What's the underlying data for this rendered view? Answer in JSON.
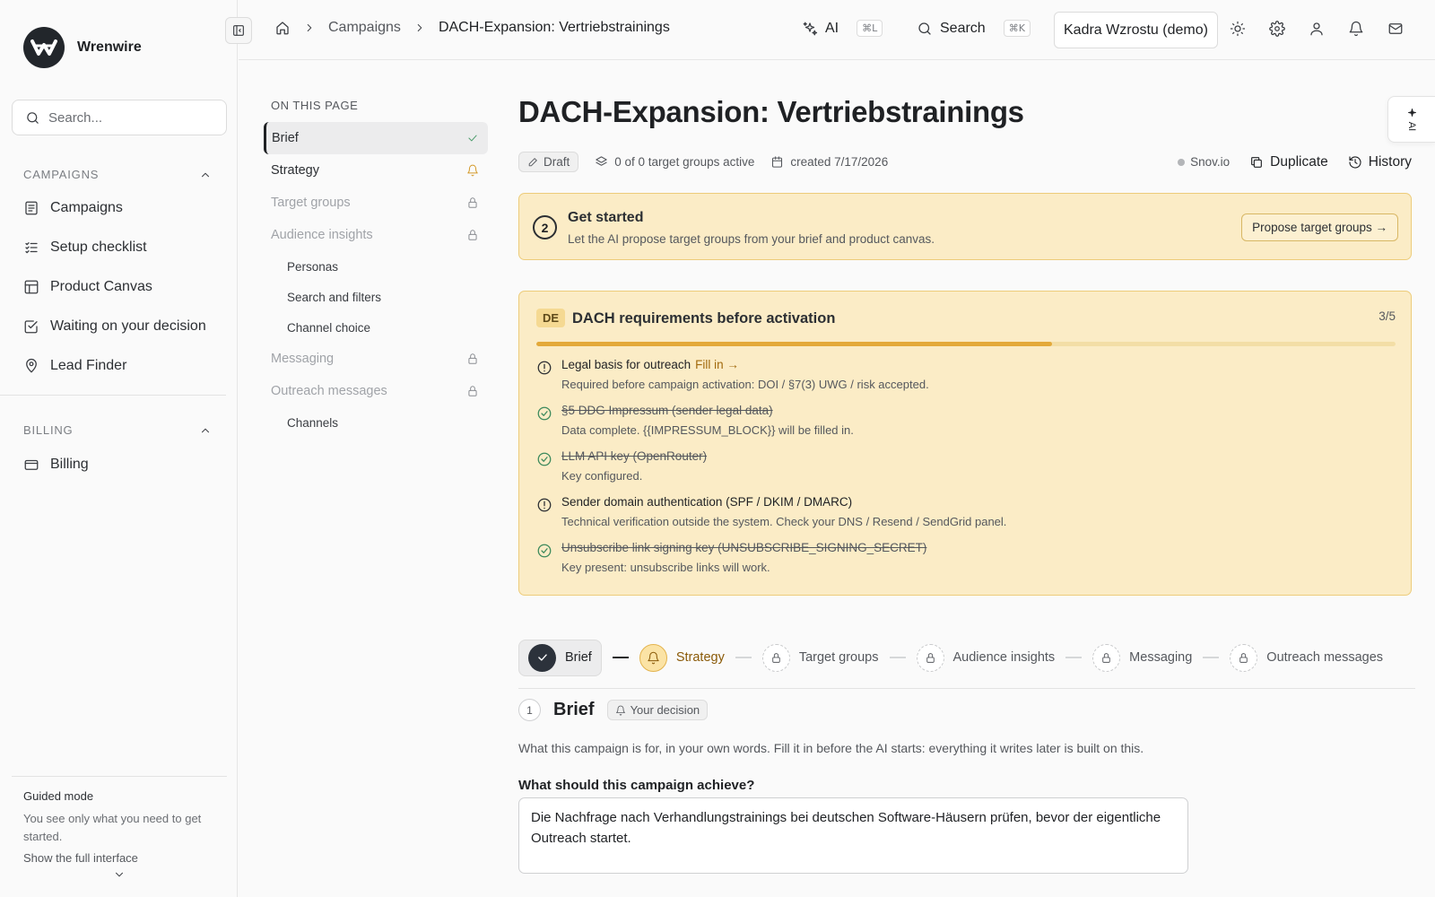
{
  "app": {
    "name": "Wrenwire"
  },
  "sidebar": {
    "search_placeholder": "Search...",
    "sections": [
      {
        "label": "CAMPAIGNS",
        "items": [
          {
            "label": "Campaigns",
            "icon": "list-icon"
          },
          {
            "label": "Setup checklist",
            "icon": "checklist-icon"
          },
          {
            "label": "Product Canvas",
            "icon": "layout-icon"
          },
          {
            "label": "Waiting on your decision",
            "icon": "check-square-icon"
          },
          {
            "label": "Lead Finder",
            "icon": "map-pin-icon"
          }
        ]
      },
      {
        "label": "BILLING",
        "items": [
          {
            "label": "Billing",
            "icon": "credit-card-icon"
          }
        ]
      }
    ],
    "guided": {
      "title": "Guided mode",
      "description": "You see only what you need to get started.",
      "link": "Show the full interface"
    }
  },
  "topbar": {
    "breadcrumbs": [
      "Campaigns",
      "DACH-Expansion: Vertriebstrainings"
    ],
    "ai_label": "AI",
    "ai_shortcut": "⌘L",
    "search_label": "Search",
    "search_shortcut": "⌘K",
    "workspace": "Kadra Wzrostu (demo)"
  },
  "toc": {
    "title": "ON THIS PAGE",
    "items": [
      {
        "label": "Brief",
        "state": "done"
      },
      {
        "label": "Strategy",
        "state": "current"
      },
      {
        "label": "Target groups",
        "state": "locked"
      },
      {
        "label": "Audience insights",
        "state": "locked"
      },
      {
        "label": "Personas",
        "state": "sub"
      },
      {
        "label": "Search and filters",
        "state": "sub"
      },
      {
        "label": "Channel choice",
        "state": "sub"
      },
      {
        "label": "Messaging",
        "state": "locked"
      },
      {
        "label": "Outreach messages",
        "state": "locked"
      },
      {
        "label": "Channels",
        "state": "sub"
      }
    ]
  },
  "page": {
    "title": "DACH-Expansion: Vertriebstrainings",
    "status": "Draft",
    "target_groups": "0 of 0 target groups active",
    "created": "created 7/17/2026",
    "integration": "Snov.io",
    "duplicate_label": "Duplicate",
    "history_label": "History"
  },
  "get_started": {
    "step": "2",
    "title": "Get started",
    "description": "Let the AI propose target groups from your brief and product canvas.",
    "button": "Propose target groups →"
  },
  "dach": {
    "tag": "DE",
    "title": "DACH requirements before activation",
    "count": "3/5",
    "progress": 0.6,
    "fill_in_label": "Fill in →",
    "requirements": [
      {
        "title": "Legal basis for outreach",
        "desc": "Required before campaign activation: DOI / §7(3) UWG / risk accepted.",
        "done": false,
        "action": true
      },
      {
        "title": "§5 DDG Impressum (sender legal data)",
        "desc": "Data complete. {{IMPRESSUM_BLOCK}} will be filled in.",
        "done": true
      },
      {
        "title": "LLM API key (OpenRouter)",
        "desc": "Key configured.",
        "done": true
      },
      {
        "title": "Sender domain authentication (SPF / DKIM / DMARC)",
        "desc": "Technical verification outside the system. Check your DNS / Resend / SendGrid panel.",
        "done": false
      },
      {
        "title": "Unsubscribe link signing key (UNSUBSCRIBE_SIGNING_SECRET)",
        "desc": "Key present: unsubscribe links will work.",
        "done": true
      }
    ]
  },
  "stepper": {
    "steps": [
      {
        "label": "Brief",
        "state": "done"
      },
      {
        "label": "Strategy",
        "state": "current"
      },
      {
        "label": "Target groups",
        "state": "locked"
      },
      {
        "label": "Audience insights",
        "state": "locked"
      },
      {
        "label": "Messaging",
        "state": "locked"
      },
      {
        "label": "Outreach messages",
        "state": "locked"
      }
    ]
  },
  "brief": {
    "number": "1",
    "title": "Brief",
    "badge": "Your decision",
    "description": "What this campaign is for, in your own words. Fill it in before the AI starts: everything it writes later is built on this.",
    "question": "What should this campaign achieve?",
    "answer": "Die Nachfrage nach Verhandlungstrainings bei deutschen Software-Häusern prüfen, bevor der eigentliche Outreach startet."
  },
  "colors": {
    "accent_warning": "#fbecc6",
    "accent_border": "#edcc7a",
    "progress": "#e3a93a",
    "dark": "#2c323b"
  }
}
